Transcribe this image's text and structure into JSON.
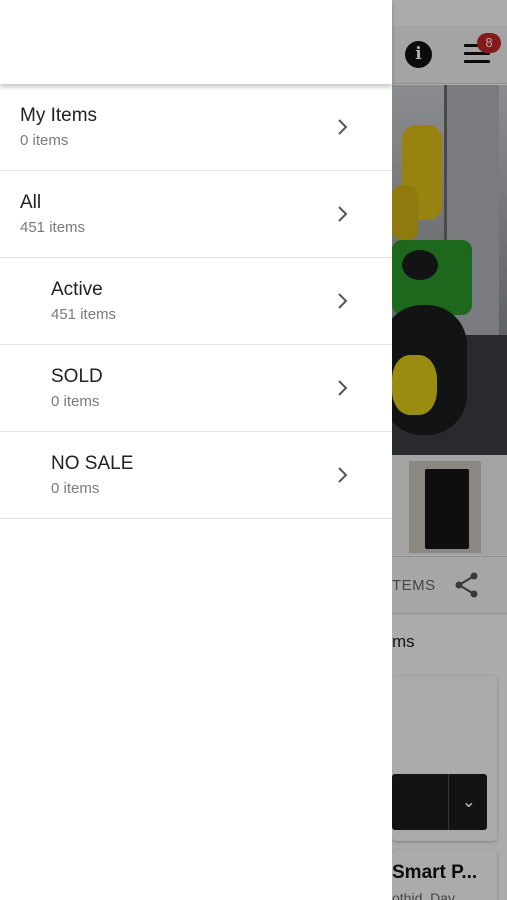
{
  "background": {
    "notification_count": "8",
    "info_glyph": "i",
    "actions_label": "TEMS",
    "section_label": "ms",
    "card_title": "Smart P...",
    "card_subtitle": "othid, Dav..."
  },
  "drawer": {
    "items": [
      {
        "title": "My Items",
        "count": "0 items",
        "level": 0
      },
      {
        "title": "All",
        "count": "451 items",
        "level": 0
      },
      {
        "title": "Active",
        "count": "451 items",
        "level": 1
      },
      {
        "title": "SOLD",
        "count": "0 items",
        "level": 1
      },
      {
        "title": "NO SALE",
        "count": "0 items",
        "level": 1
      }
    ]
  },
  "colors": {
    "badge": "#c62828",
    "scrim": "rgba(0,0,0,0.33)",
    "text_primary": "#212121",
    "text_secondary": "#7a7a7a"
  }
}
